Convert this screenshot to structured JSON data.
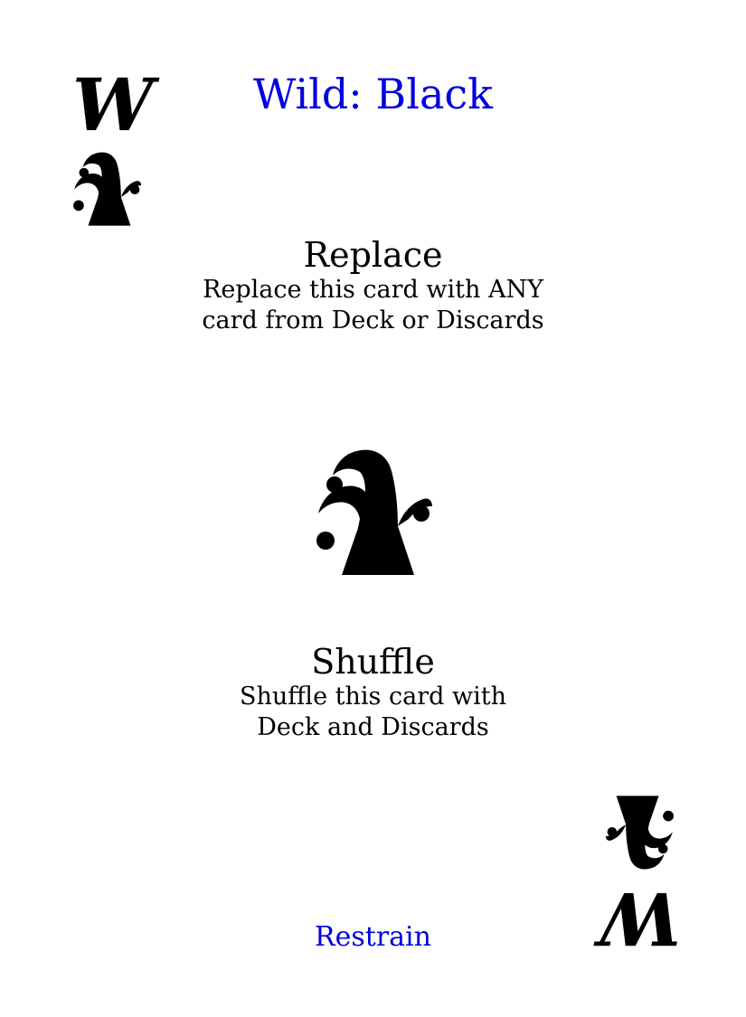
{
  "card": {
    "corner_letter": "W",
    "corner_icon": "jester-hat-icon",
    "title": "Wild: Black",
    "title_color": "#0000dd",
    "actions": [
      {
        "heading": "Replace",
        "lines": [
          "Replace this card with ANY",
          "card from Deck or Discards"
        ]
      },
      {
        "heading": "Shuffle",
        "lines": [
          "Shuffle this card with",
          "Deck and Discards"
        ]
      }
    ],
    "center_icon": "jester-hat-icon",
    "footer": "Restrain",
    "footer_color": "#0000dd",
    "ink_color": "#000000"
  }
}
